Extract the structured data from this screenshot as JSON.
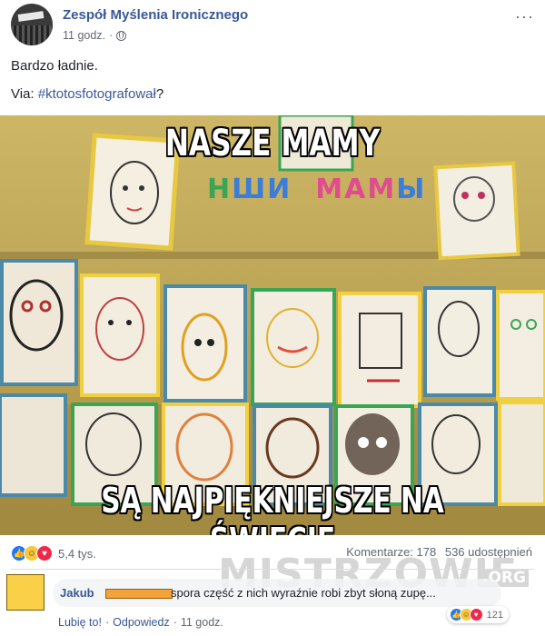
{
  "post": {
    "page_name": "Zespół Myślenia Ironicznego",
    "time": "11 godz.",
    "time_separator": "·",
    "more_icon": "···",
    "body_line1": "Bardzo ładnie.",
    "via_label": "Via: ",
    "hashtag": "#ktotosfotografował",
    "via_suffix": "?"
  },
  "image": {
    "caption_top": "NASZE MAMY",
    "caption_bottom": "SĄ NAJPIĘKNIEJSZE NA ŚWIECIE",
    "sub_letters": [
      {
        "ch": "Н",
        "color": "#3aa655"
      },
      {
        "ch": "Ш",
        "color": "#3b7dd8"
      },
      {
        "ch": "И",
        "color": "#3b7dd8"
      },
      {
        "ch": "М",
        "color": "#e04d8f"
      },
      {
        "ch": "А",
        "color": "#e04d8f"
      },
      {
        "ch": "М",
        "color": "#e04d8f"
      },
      {
        "ch": "Ы",
        "color": "#3b7dd8"
      }
    ]
  },
  "stats": {
    "reaction_count": "5,4 tys.",
    "comments": "Komentarze: 178",
    "shares": "536 udostępnień"
  },
  "watermark": {
    "main": "MISTRZOWIE",
    "suffix": ".ORG"
  },
  "comment": {
    "author": "Jakub",
    "text": "spora część z nich wyraźnie robi zbyt słoną zupę...",
    "reaction_count": "121",
    "like_action": "Lubię to!",
    "reply_action": "Odpowiedz",
    "separator": "·",
    "time": "11 godz."
  },
  "colors": {
    "link": "#385898",
    "like": "#2078f4",
    "love": "#f0284a",
    "haha": "#f7c83d",
    "meta": "#606770"
  },
  "icons": {
    "globe": "globe-icon",
    "more": "more-options-icon",
    "like": "like-reaction-icon",
    "haha": "haha-reaction-icon",
    "love": "love-reaction-icon"
  }
}
